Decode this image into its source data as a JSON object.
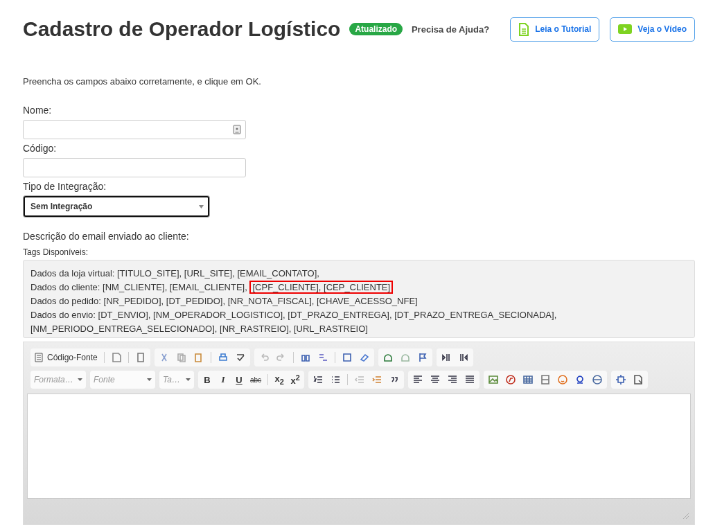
{
  "header": {
    "title": "Cadastro de Operador Logístico",
    "badge": "Atualizado",
    "help_label": "Precisa de Ajuda?",
    "help_buttons": [
      {
        "kind": "document",
        "label": "Leia o Tutorial"
      },
      {
        "kind": "video",
        "label": "Veja o Vídeo"
      }
    ]
  },
  "intro": "Preencha os campos abaixo corretamente, e clique em OK.",
  "fields": [
    {
      "kind": "text",
      "label": "Nome:",
      "has_contact_icon": true
    },
    {
      "kind": "text",
      "label": "Código:",
      "has_contact_icon": false
    },
    {
      "kind": "select",
      "label": "Tipo de Integração:",
      "value": "Sem Integração"
    }
  ],
  "email": {
    "label": "Descrição do email enviado ao cliente:",
    "tags_label": "Tags Disponíveis:",
    "tag_lines": [
      [
        {
          "text": "Dados da loja virtual: [TITULO_SITE], [URL_SITE], [EMAIL_CONTATO],",
          "highlighted": false
        }
      ],
      [
        {
          "text": "Dados do cliente: [NM_CLIENTE], [EMAIL_CLIENTE],",
          "highlighted": false
        },
        {
          "text": "[CPF_CLIENTE], [CEP_CLIENTE]",
          "highlighted": true
        }
      ],
      [
        {
          "text": "Dados do pedido: [NR_PEDIDO], [DT_PEDIDO], [NR_NOTA_FISCAL], [CHAVE_ACESSO_NFE]",
          "highlighted": false
        }
      ],
      [
        {
          "text": "Dados do envio: [DT_ENVIO], [NM_OPERADOR_LOGISTICO], [DT_PRAZO_ENTREGA], [DT_PRAZO_ENTREGA_SECIONADA], [NM_PERIODO_ENTREGA_SELECIONADO], [NR_RASTREIO], [URL_RASTREIO]",
          "highlighted": false
        }
      ]
    ]
  },
  "editor": {
    "source_button": "Código-Fonte",
    "combos": [
      "Formata…",
      "Fonte",
      "Ta…"
    ],
    "text_buttons": [
      "B",
      "I",
      "U",
      "abc",
      "x$_{2}$",
      "x$^{2}$"
    ]
  }
}
